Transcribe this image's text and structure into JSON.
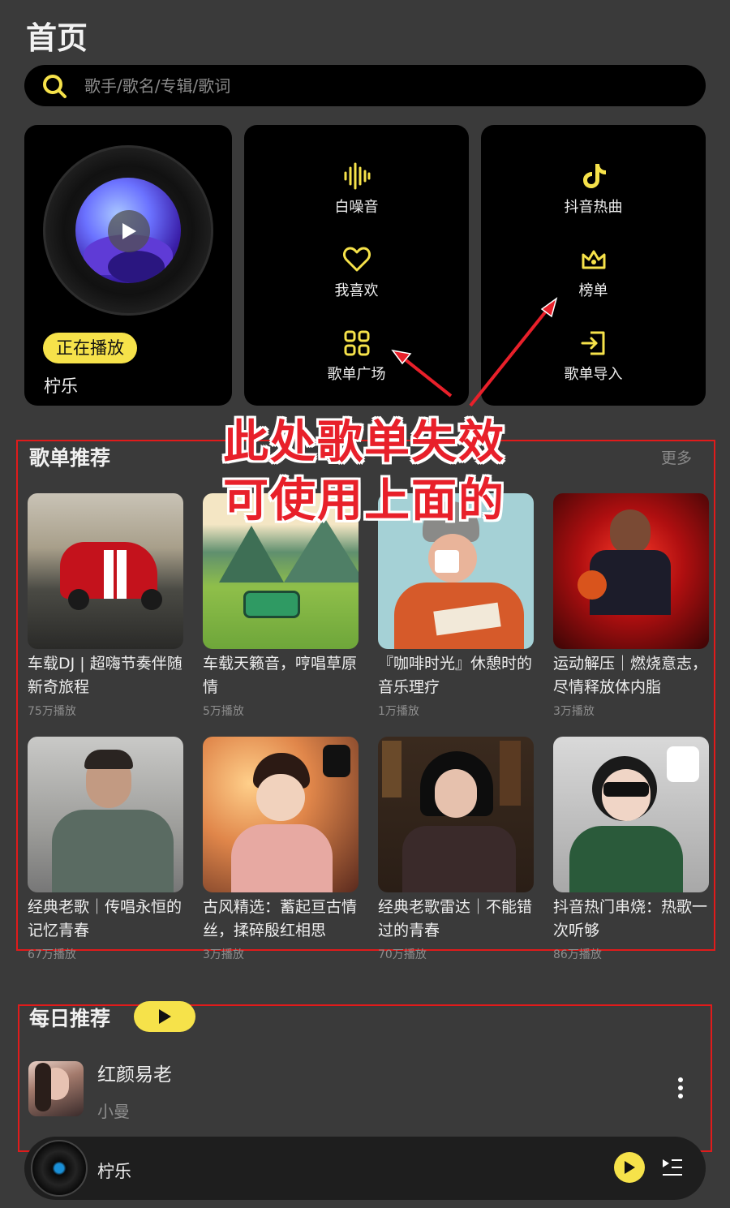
{
  "header": {
    "title": "首页"
  },
  "search": {
    "placeholder": "歌手/歌名/专辑/歌词"
  },
  "now_playing": {
    "badge": "正在播放",
    "title": "柠乐"
  },
  "menu_mid": [
    {
      "label": "白噪音",
      "icon": "waveform-icon"
    },
    {
      "label": "我喜欢",
      "icon": "heart-icon"
    },
    {
      "label": "歌单广场",
      "icon": "grid-icon"
    }
  ],
  "menu_right": [
    {
      "label": "抖音热曲",
      "icon": "tiktok-icon"
    },
    {
      "label": "榜单",
      "icon": "crown-icon"
    },
    {
      "label": "歌单导入",
      "icon": "import-icon"
    }
  ],
  "annotation": {
    "line1": "此处歌单失效",
    "line2": "可使用上面的"
  },
  "playlists": {
    "title": "歌单推荐",
    "more": "更多",
    "items": [
      {
        "title": "车载DJ | 超嗨节奏伴随新奇旅程",
        "plays": "75万播放"
      },
      {
        "title": "车载天籁音，哼唱草原情",
        "plays": "5万播放"
      },
      {
        "title": "『咖啡时光』休憩时的音乐理疗",
        "plays": "1万播放"
      },
      {
        "title": "运动解压｜燃烧意志，尽情释放体内脂",
        "plays": "3万播放"
      },
      {
        "title": "经典老歌｜传唱永恒的记忆青春",
        "plays": "67万播放"
      },
      {
        "title": "古风精选：蓄起亘古情丝，揉碎殷红相思",
        "plays": "3万播放"
      },
      {
        "title": "经典老歌雷达｜不能错过的青春",
        "plays": "70万播放"
      },
      {
        "title": "抖音热门串烧：热歌一次听够",
        "plays": "86万播放"
      }
    ]
  },
  "daily": {
    "title": "每日推荐",
    "song": {
      "title": "红颜易老",
      "artist": "小曼"
    }
  },
  "mini_player": {
    "title": "柠乐"
  },
  "colors": {
    "accent": "#f6e24a",
    "background": "#3a3a3a",
    "card": "#000000",
    "annotation_red": "#e8202a"
  }
}
